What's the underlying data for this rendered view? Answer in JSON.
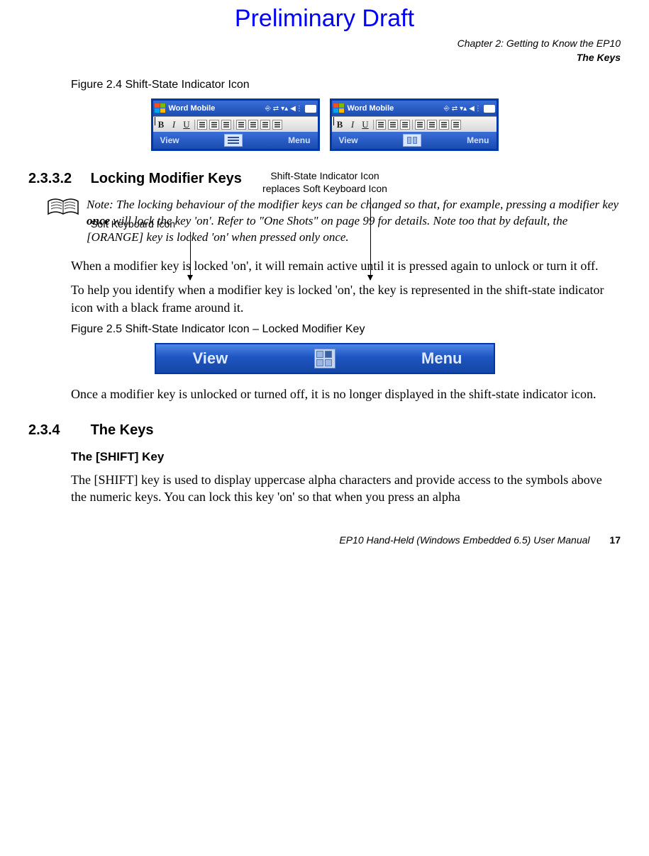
{
  "watermark": "Preliminary Draft",
  "header": {
    "chapter": "Chapter 2: Getting to Know the EP10",
    "section": "The Keys"
  },
  "figure24": {
    "caption": "Figure 2.4  Shift-State Indicator Icon",
    "label_soft_kbd": "Soft Keyboard Icon",
    "label_shift_replaces_l1": "Shift-State Indicator Icon",
    "label_shift_replaces_l2": "replaces Soft Keyboard Icon",
    "device": {
      "title": "Word Mobile",
      "ok": "ok",
      "view": "View",
      "menu": "Menu",
      "bold": "B",
      "italic": "I",
      "underline": "U"
    }
  },
  "sec2332": {
    "number": "2.3.3.2",
    "title": "Locking Modifier Keys"
  },
  "note": {
    "label": "Note:",
    "text_pre": "The locking behaviour of the modifier keys can be changed so that, for example, pressing a modifier key ",
    "once": "once",
    "text_post": " will lock the key 'on'. Refer to \"One Shots\" on page 99 for details. Note too that by default, the [ORANGE] key is locked 'on' when pressed only once."
  },
  "para1": "When a modifier key is locked 'on', it will remain active until it is pressed again to unlock or turn it off.",
  "para2": "To help you identify when a modifier key is locked 'on', the key is represented in the shift-state indicator icon with a black frame around it.",
  "figure25": {
    "caption": "Figure 2.5  Shift-State Indicator Icon – Locked Modifier Key",
    "view": "View",
    "menu": "Menu"
  },
  "para3": "Once a modifier key is unlocked or turned off, it is no longer displayed in the shift-state indicator icon.",
  "sec234": {
    "number": "2.3.4",
    "title": "The Keys"
  },
  "shift_heading": "The [SHIFT] Key",
  "para4": "The [SHIFT] key is used to display uppercase alpha characters and provide access to the symbols above the numeric keys. You can lock this key 'on' so that when you press an alpha",
  "footer": {
    "manual": "EP10 Hand-Held (Windows Embedded 6.5) User Manual",
    "page": "17"
  }
}
